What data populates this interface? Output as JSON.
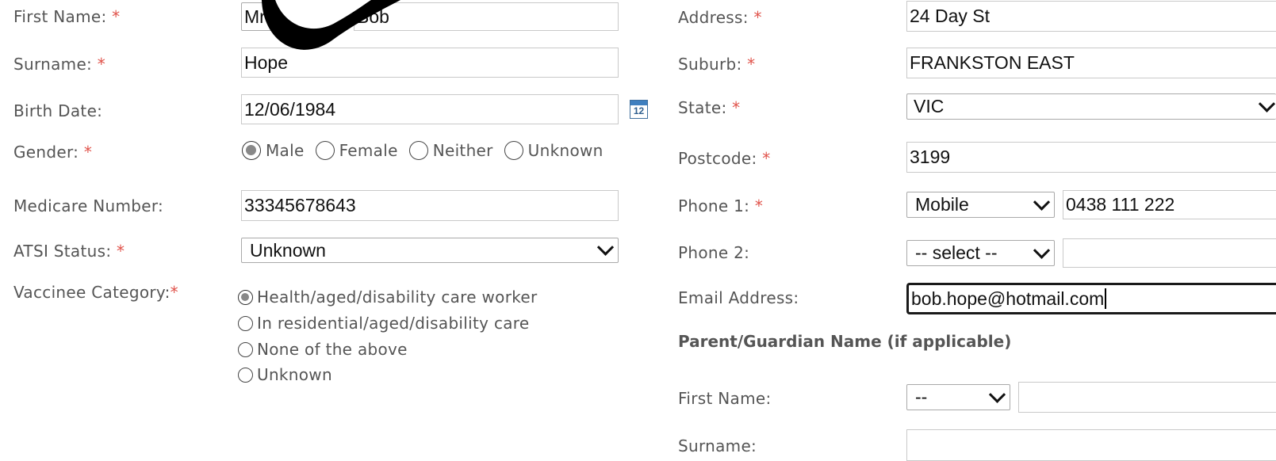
{
  "left": {
    "first_name": {
      "label": "First Name:",
      "required": "*",
      "title_value": "Mr",
      "value": "Bob"
    },
    "surname": {
      "label": "Surname:",
      "required": "*",
      "value": "Hope"
    },
    "birth_date": {
      "label": "Birth Date:",
      "value": "12/06/1984",
      "calendar_icon_text": "12"
    },
    "gender": {
      "label": "Gender:",
      "required": "*",
      "options": [
        "Male",
        "Female",
        "Neither",
        "Unknown"
      ],
      "selected": "Male"
    },
    "medicare": {
      "label": "Medicare Number:",
      "value": "33345678643"
    },
    "atsi": {
      "label": "ATSI Status:",
      "required": "*",
      "value": "Unknown"
    },
    "vaccinee": {
      "label": "Vaccinee Category:",
      "required": "*",
      "options": [
        "Health/aged/disability care worker",
        "In residential/aged/disability care",
        "None of the above",
        "Unknown"
      ],
      "selected": "Health/aged/disability care worker"
    }
  },
  "right": {
    "address": {
      "label": "Address:",
      "required": "*",
      "value": "24 Day St"
    },
    "suburb": {
      "label": "Suburb:",
      "required": "*",
      "value": "FRANKSTON EAST"
    },
    "state": {
      "label": "State:",
      "required": "*",
      "value": "VIC"
    },
    "postcode": {
      "label": "Postcode:",
      "required": "*",
      "value": "3199"
    },
    "phone1": {
      "label": "Phone 1:",
      "required": "*",
      "type": "Mobile",
      "value": "0438 111 222"
    },
    "phone2": {
      "label": "Phone 2:",
      "type": "-- select --",
      "value": ""
    },
    "email": {
      "label": "Email Address:",
      "value": "bob.hope@hotmail.com"
    },
    "guardian": {
      "title": "Parent/Guardian Name (if applicable)",
      "first_name": {
        "label": "First Name:",
        "title_value": "--",
        "value": ""
      },
      "surname": {
        "label": "Surname:",
        "value": ""
      }
    }
  },
  "colors": {
    "required": "#e0524a",
    "label": "#555555",
    "border": "#c9c9c9",
    "overlay": "#000000"
  }
}
